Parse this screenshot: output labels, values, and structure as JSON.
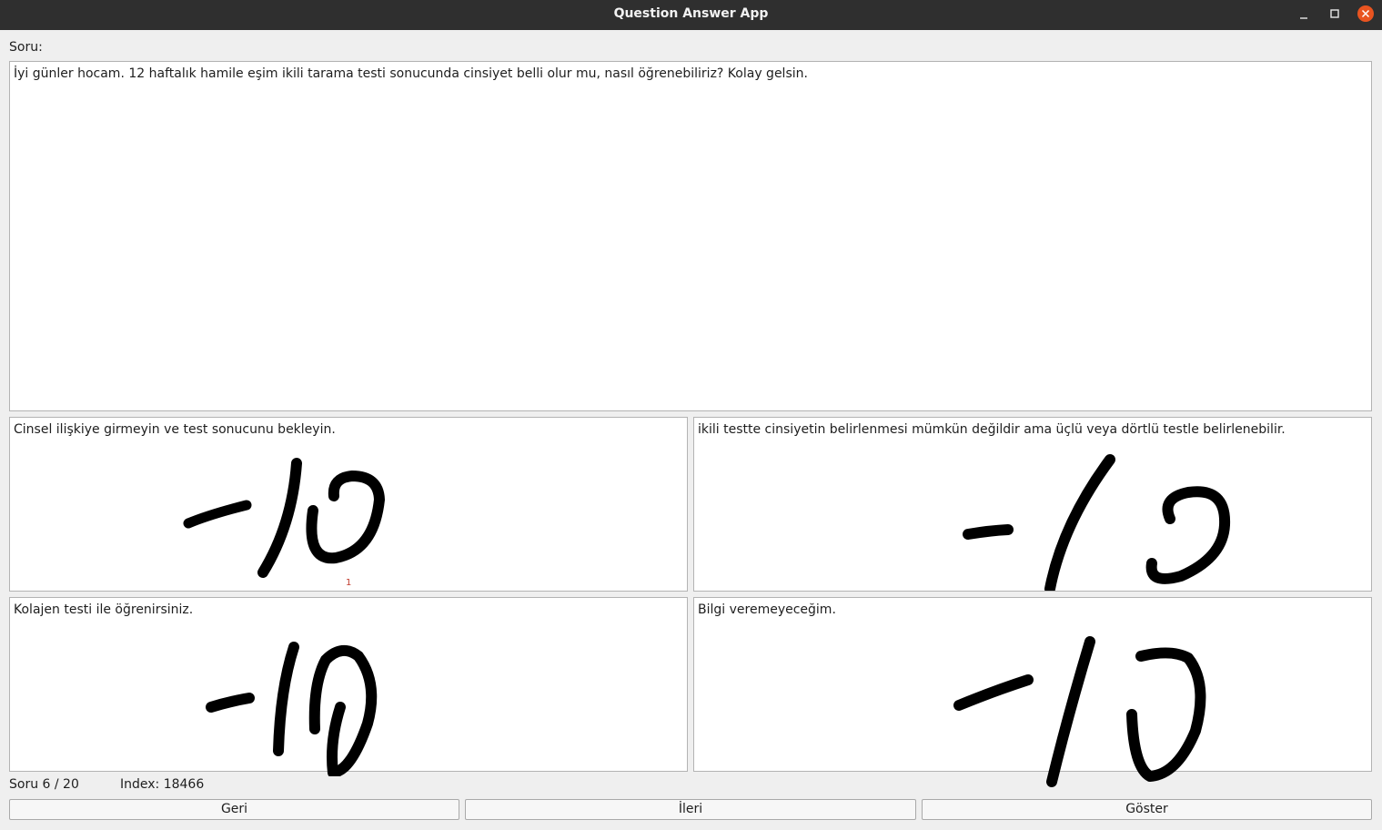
{
  "window": {
    "title": "Question Answer App",
    "controls": [
      "minimize-icon",
      "maximize-icon",
      "close-icon"
    ],
    "close_color": "#e95420"
  },
  "question": {
    "label": "Soru:",
    "text": "İyi günler hocam. 12 haftalık hamile eşim ikili tarama testi sonucunda cinsiyet belli olur mu, nasıl öğrenebiliriz? Kolay gelsin."
  },
  "answers": [
    {
      "text": "Cinsel ilişkiye girmeyin ve test sonucunu bekleyin.",
      "handwritten_score": "-1/0",
      "marker": "1"
    },
    {
      "text": "ikili testte cinsiyetin belirlenmesi mümkün değildir ama üçlü veya dörtlü testle belirlenebilir.",
      "handwritten_score": "-1/0"
    },
    {
      "text": "Kolajen testi ile öğrenirsiniz.",
      "handwritten_score": "-1/0"
    },
    {
      "text": "Bilgi veremeyeceğim.",
      "handwritten_score": "-1/0"
    }
  ],
  "status": {
    "progress": "Soru 6 / 20",
    "index": "Index: 18466"
  },
  "buttons": {
    "back": "Geri",
    "next": "İleri",
    "show": "Göster"
  }
}
